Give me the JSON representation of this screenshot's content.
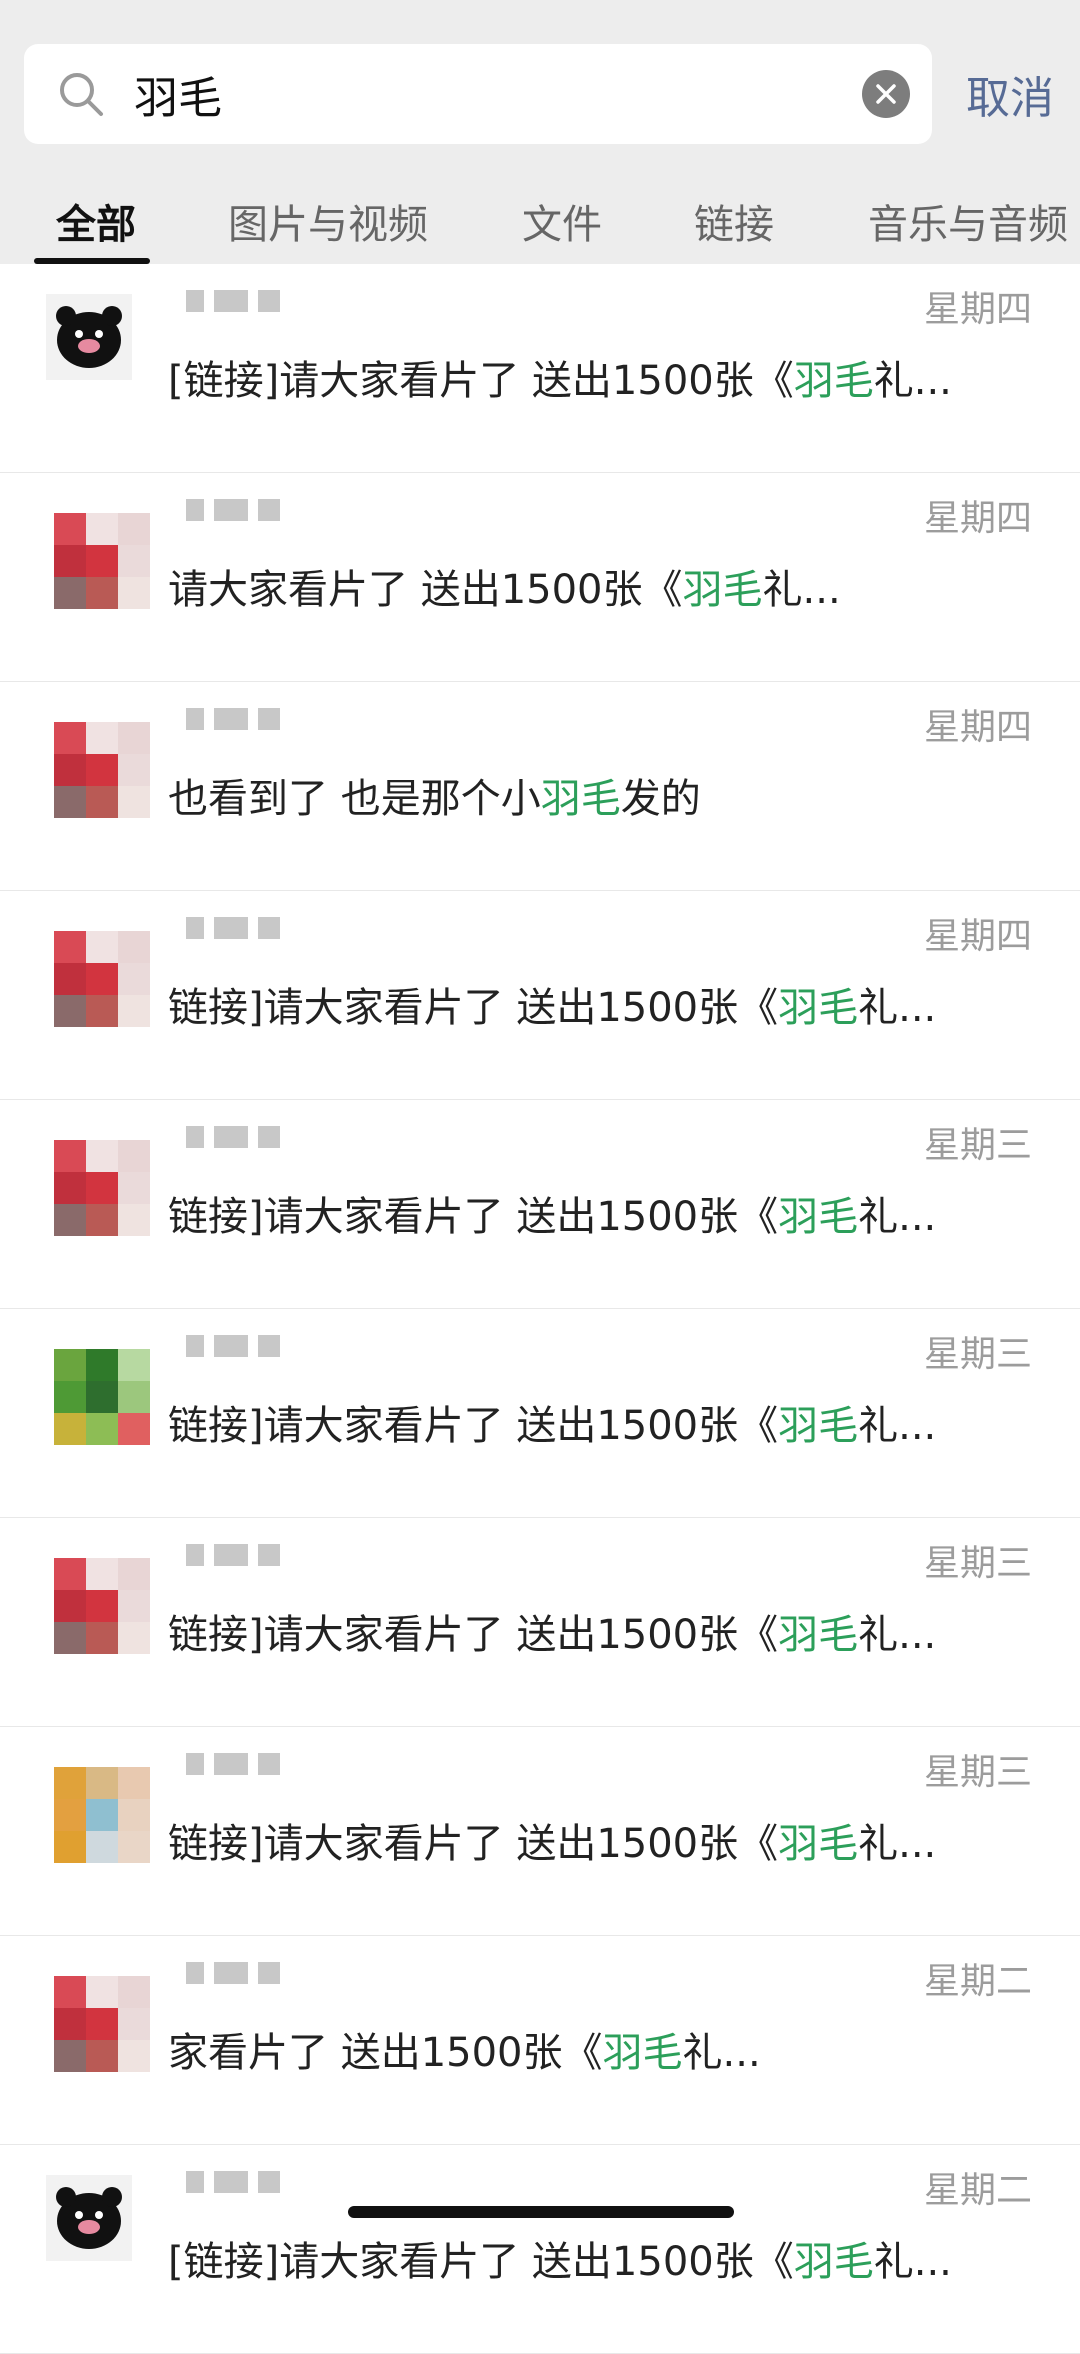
{
  "search": {
    "query": "羽毛",
    "cancel_label": "取消"
  },
  "tabs": [
    {
      "label": "全部",
      "active": true
    },
    {
      "label": "图片与视频",
      "active": false
    },
    {
      "label": "文件",
      "active": false
    },
    {
      "label": "链接",
      "active": false
    },
    {
      "label": "音乐与音频",
      "active": false
    }
  ],
  "results": [
    {
      "avatar": "pig",
      "day": "星期四",
      "prefix": "[链接]请大家看片了 送出1500张《",
      "highlight": "羽毛",
      "suffix": "礼..."
    },
    {
      "avatar": "red",
      "day": "星期四",
      "prefix": "请大家看片了 送出1500张《",
      "highlight": "羽毛",
      "suffix": "礼..."
    },
    {
      "avatar": "red",
      "day": "星期四",
      "prefix": "也看到了  也是那个小",
      "highlight": "羽毛",
      "suffix": "发的"
    },
    {
      "avatar": "red",
      "day": "星期四",
      "prefix": "链接]请大家看片了 送出1500张《",
      "highlight": "羽毛",
      "suffix": "礼..."
    },
    {
      "avatar": "red",
      "day": "星期三",
      "prefix": "链接]请大家看片了 送出1500张《",
      "highlight": "羽毛",
      "suffix": "礼..."
    },
    {
      "avatar": "green",
      "day": "星期三",
      "prefix": "链接]请大家看片了 送出1500张《",
      "highlight": "羽毛",
      "suffix": "礼..."
    },
    {
      "avatar": "red",
      "day": "星期三",
      "prefix": "链接]请大家看片了 送出1500张《",
      "highlight": "羽毛",
      "suffix": "礼..."
    },
    {
      "avatar": "orange",
      "day": "星期三",
      "prefix": "链接]请大家看片了 送出1500张《",
      "highlight": "羽毛",
      "suffix": "礼..."
    },
    {
      "avatar": "red",
      "day": "星期二",
      "prefix": "家看片了 送出1500张《",
      "highlight": "羽毛",
      "suffix": "礼..."
    },
    {
      "avatar": "pig",
      "day": "星期二",
      "prefix": "[链接]请大家看片了 送出1500张《",
      "highlight": "羽毛",
      "suffix": "礼..."
    }
  ],
  "colors": {
    "highlight": "#2c9f5a",
    "cancel": "#576b95",
    "day": "#9c9c9c",
    "background_top": "#ededed"
  },
  "icons": [
    "search-icon",
    "clear-icon"
  ]
}
